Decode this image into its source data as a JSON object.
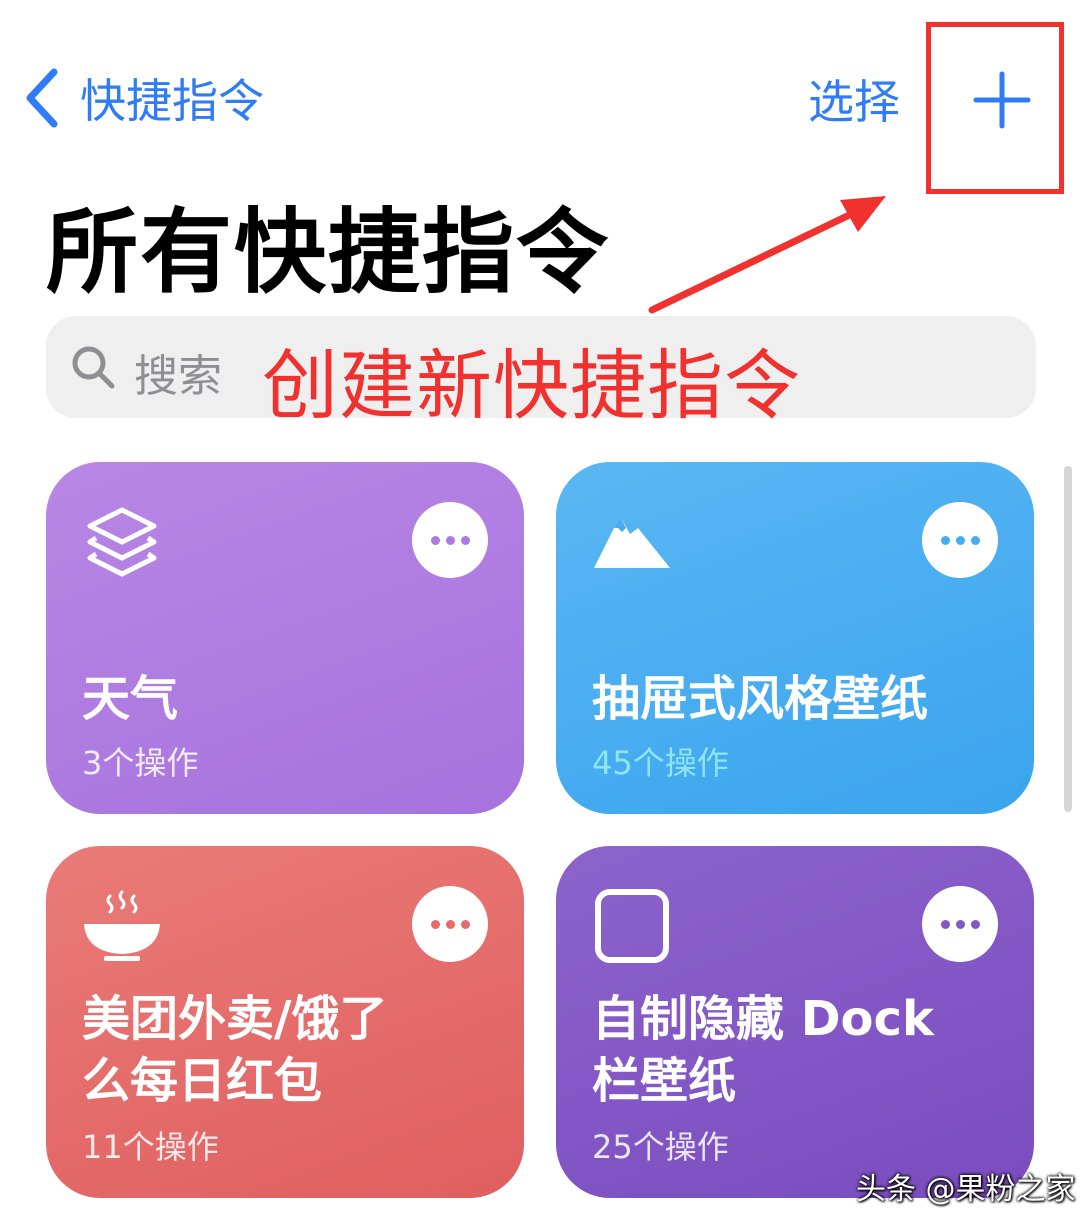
{
  "nav": {
    "back_label": "快捷指令",
    "select_label": "选择"
  },
  "page_title": "所有快捷指令",
  "search": {
    "placeholder": "搜索"
  },
  "annotation": {
    "text": "创建新快捷指令",
    "color": "#f0312e"
  },
  "cards": [
    {
      "title": "天气",
      "subtitle": "3个操作",
      "icon": "layers-icon",
      "color": "#ad7ae1"
    },
    {
      "title": "抽屉式风格壁纸",
      "subtitle": "45个操作",
      "icon": "mountain-icon",
      "color": "#46adf0"
    },
    {
      "title_line1": "美团外卖/饿了",
      "title_line2": "么每日红包",
      "subtitle": "11个操作",
      "icon": "bowl-icon",
      "color": "#e46b6a"
    },
    {
      "title_line1": "自制隐藏 Dock",
      "title_line2": "栏壁纸",
      "subtitle": "25个操作",
      "icon": "square-icon",
      "color": "#8357c5"
    }
  ],
  "watermark": "头条 @果粉之家",
  "accent_color": "#2f7cf6"
}
